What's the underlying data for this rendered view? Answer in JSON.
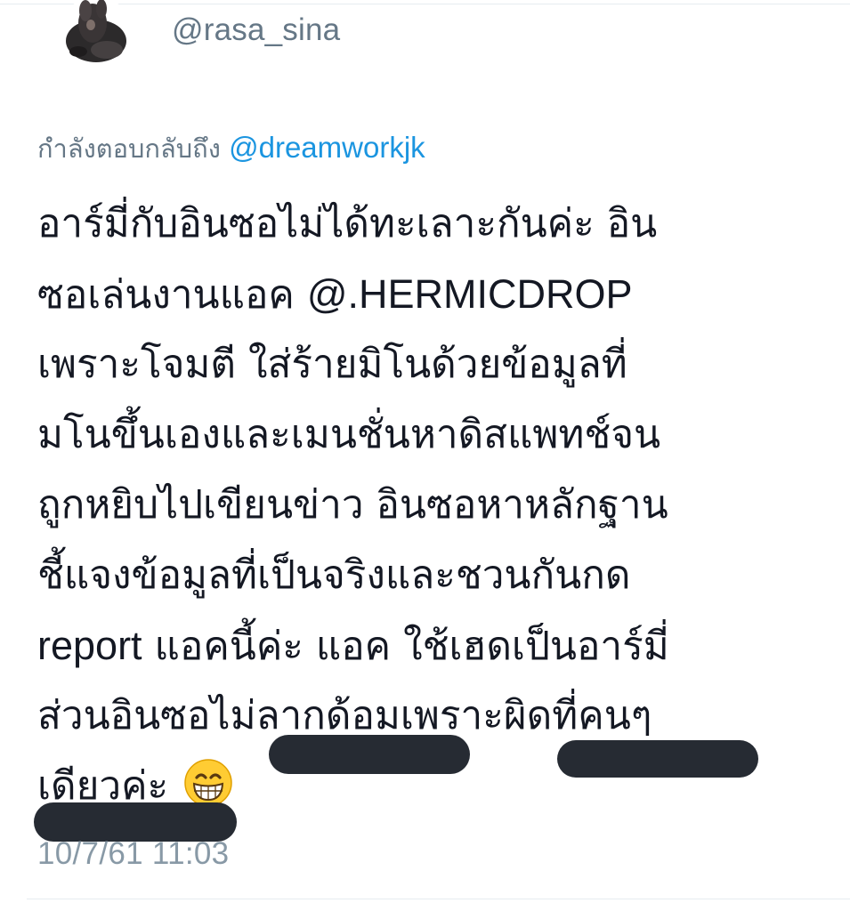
{
  "tweet": {
    "handle": "@rasa_sina",
    "reply_prefix": "กำลังตอบกลับถึง",
    "reply_to": "@dreamworkjk",
    "lines": [
      "อาร์มี่กับอินซอไม่ได้ทะเลาะกันค่ะ อิน",
      "ซอเล่นงานแอค ",
      "@.HERMICDROP",
      "เพราะโจมตี ใส่ร้ายมิโนด้วยข้อมูลที่",
      "มโนขึ้นเองและเมนชั่นหาดิสแพทช์จน",
      "ถูกหยิบไปเขียนข่าว อินซอหาหลักฐาน",
      "ชี้แจงข้อมูลที่เป็นจริงและชวนกันกด",
      "report",
      " แอคนี้ค่ะ แอค ใช้เฮดเป็นอาร์มี่",
      "ส่วนอินซอไม่ลากด้อมเพราะผิดที่คนๆ",
      "เดียวค่ะ "
    ],
    "emoji": "grinning-face-with-smiling-eyes",
    "timestamp": "10/7/61 11:03"
  },
  "colors": {
    "text": "#141823",
    "muted": "#657786",
    "link": "#1b95e0",
    "timestamp": "#8899a6",
    "redaction": "#262b33",
    "divider": "#e6ecf0"
  }
}
